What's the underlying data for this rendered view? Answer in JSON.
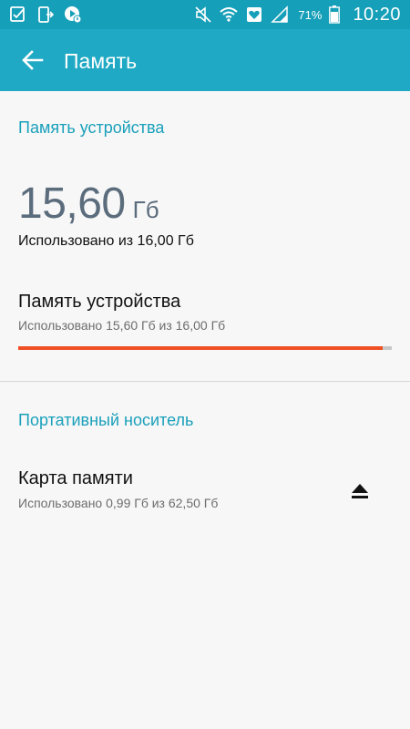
{
  "status_bar": {
    "battery_percent": "71%",
    "time": "10:20",
    "icons_left": [
      "checkbox-notification-icon",
      "phone-notification-icon",
      "google-play-notification-icon"
    ],
    "icons_right": [
      "mute-icon",
      "wifi-icon",
      "heart-notification-icon",
      "signal-icon",
      "battery-icon"
    ]
  },
  "app_bar": {
    "title": "Память",
    "background": "#1fa9c4"
  },
  "device_section": {
    "header": "Память устройства",
    "used_value": "15,60",
    "used_unit": "Гб",
    "used_of_total": "Использовано из 16,00 Гб",
    "item": {
      "title": "Память устройства",
      "subtitle": "Использовано 15,60 Гб из 16,00 Гб",
      "progress_fraction": 0.975,
      "progress_color": "#f04e23"
    }
  },
  "portable_section": {
    "header": "Портативный носитель",
    "item": {
      "title": "Карта памяти",
      "subtitle": "Использовано 0,99 Гб из 62,50 Гб",
      "action_icon": "eject-icon"
    }
  },
  "colors": {
    "accent": "#1aa0bb",
    "status_bar": "#169fb8",
    "big_value": "#5b6c7c"
  }
}
